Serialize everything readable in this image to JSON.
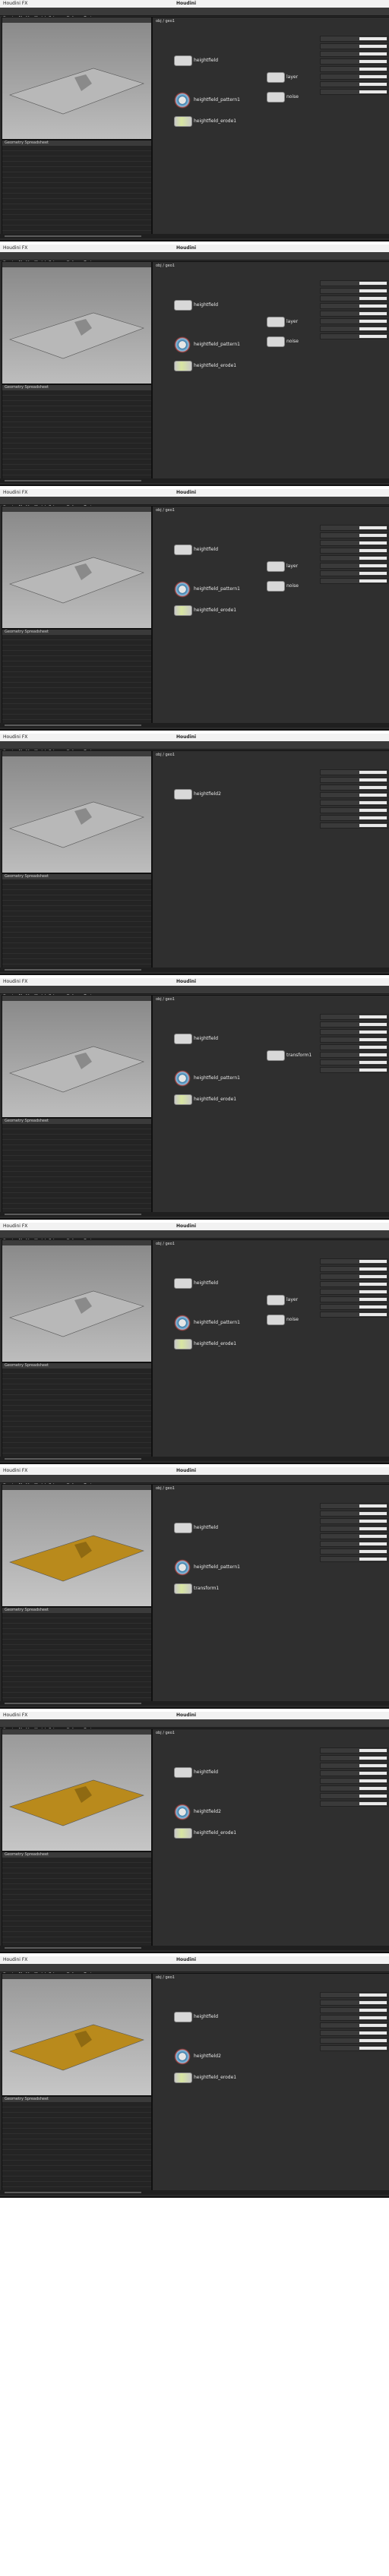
{
  "app": {
    "brand": "Houdini",
    "title_left": "Houdini FX",
    "colors": {
      "terrain_gray": "#b8b8b8",
      "terrain_orange": "#b98a1c",
      "node": "#d8d8d8",
      "network_bg": "#2f2f2f"
    }
  },
  "frames": [
    {
      "shelf_tabs": [
        "Create",
        "Modify",
        "Model",
        "Polygon",
        "Deform",
        "Texture"
      ],
      "viewport_label": "Scene View",
      "sheet_header": "Geometry Spreadsheet",
      "net_path": "obj / geo1",
      "nodes": [
        "heightfield",
        "heightfield_pattern1",
        "heightfield_erode1",
        "layer",
        "noise"
      ],
      "terrain": "gray"
    },
    {
      "shelf_tabs": [
        "Create",
        "Modify",
        "Model",
        "Polygon",
        "Deform",
        "Texture"
      ],
      "viewport_label": "Scene View",
      "sheet_header": "Geometry Spreadsheet",
      "net_path": "obj / geo1",
      "nodes": [
        "heightfield",
        "heightfield_pattern1",
        "heightfield_erode1",
        "layer",
        "noise"
      ],
      "terrain": "gray"
    },
    {
      "shelf_tabs": [
        "Create",
        "Modify",
        "Model",
        "Polygon",
        "Deform",
        "Texture"
      ],
      "viewport_label": "Scene View",
      "sheet_header": "Geometry Spreadsheet",
      "net_path": "obj / geo1",
      "nodes": [
        "heightfield",
        "heightfield_pattern1",
        "heightfield_erode1",
        "layer",
        "noise"
      ],
      "terrain": "gray"
    },
    {
      "shelf_tabs": [
        "Create",
        "Modify",
        "Model",
        "Polygon",
        "Deform",
        "Texture"
      ],
      "viewport_label": "Scene View",
      "sheet_header": "Geometry Spreadsheet",
      "net_path": "obj / geo1",
      "nodes": [
        "heightfield2"
      ],
      "terrain": "gray"
    },
    {
      "shelf_tabs": [
        "Create",
        "Modify",
        "Model",
        "Polygon",
        "Deform",
        "Texture"
      ],
      "viewport_label": "Scene View",
      "sheet_header": "Geometry Spreadsheet",
      "net_path": "obj / geo1",
      "nodes": [
        "heightfield",
        "heightfield_pattern1",
        "heightfield_erode1",
        "transform1"
      ],
      "terrain": "gray"
    },
    {
      "shelf_tabs": [
        "Create",
        "Modify",
        "Model",
        "Polygon",
        "Deform",
        "Texture"
      ],
      "viewport_label": "Scene View",
      "sheet_header": "Geometry Spreadsheet",
      "net_path": "obj / geo1",
      "nodes": [
        "heightfield",
        "heightfield_pattern1",
        "heightfield_erode1",
        "layer",
        "noise"
      ],
      "terrain": "gray"
    },
    {
      "shelf_tabs": [
        "Create",
        "Modify",
        "Model",
        "Polygon",
        "Deform",
        "Texture"
      ],
      "viewport_label": "Scene View",
      "sheet_header": "Geometry Spreadsheet",
      "net_path": "obj / geo1",
      "nodes": [
        "heightfield",
        "heightfield_pattern1",
        "transform1"
      ],
      "terrain": "orange"
    },
    {
      "shelf_tabs": [
        "Create",
        "Modify",
        "Model",
        "Polygon",
        "Deform",
        "Texture"
      ],
      "viewport_label": "Scene View",
      "sheet_header": "Geometry Spreadsheet",
      "net_path": "obj / geo1",
      "nodes": [
        "heightfield",
        "heightfield2",
        "heightfield_erode1"
      ],
      "terrain": "orange"
    },
    {
      "shelf_tabs": [
        "Create",
        "Modify",
        "Model",
        "Polygon",
        "Deform",
        "Texture"
      ],
      "viewport_label": "Scene View",
      "sheet_header": "Geometry Spreadsheet",
      "net_path": "obj / geo1",
      "nodes": [
        "heightfield",
        "heightfield2",
        "heightfield_erode1"
      ],
      "terrain": "orange"
    }
  ]
}
